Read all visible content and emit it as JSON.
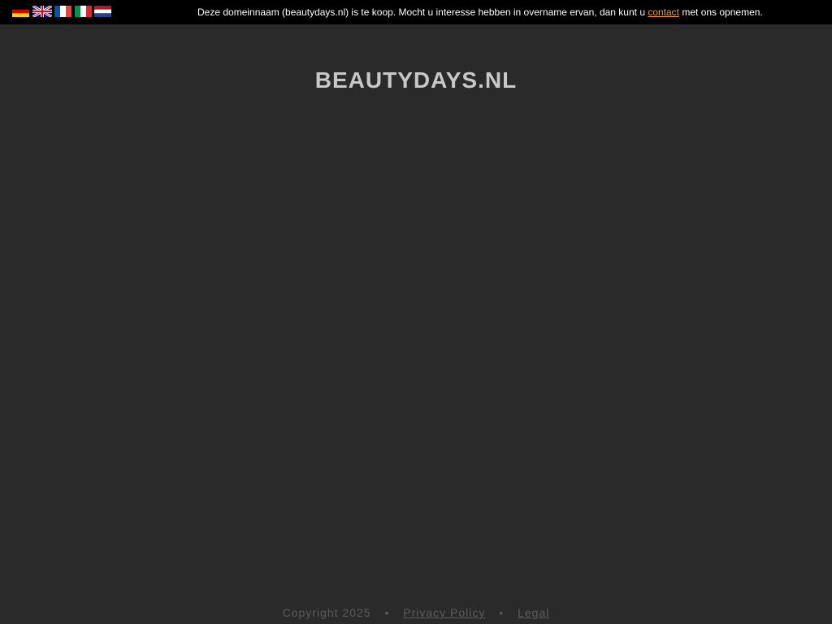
{
  "topbar": {
    "languages": [
      {
        "code": "de",
        "icon": "flag-de-icon"
      },
      {
        "code": "en",
        "icon": "flag-gb-icon"
      },
      {
        "code": "fr",
        "icon": "flag-fr-icon"
      },
      {
        "code": "it",
        "icon": "flag-it-icon"
      },
      {
        "code": "nl",
        "icon": "flag-nl-icon"
      }
    ],
    "notice_before": "Deze domeinnaam (beautydays.nl) is te koop. Mocht u interesse hebben in overname ervan, dan kunt u ",
    "notice_link": "contact",
    "notice_after": " met ons opnemen.",
    "link_color": "#f0a030"
  },
  "main": {
    "title": "BEAUTYDAYS.NL"
  },
  "footer": {
    "copyright": "Copyright 2025",
    "separator": "•",
    "privacy_label": "Privacy Policy",
    "legal_label": "Legal"
  },
  "colors": {
    "background": "#2a2a2a",
    "topbar": "#000000",
    "title": "#c8c8c8",
    "footer_text": "#5c5c5c"
  }
}
